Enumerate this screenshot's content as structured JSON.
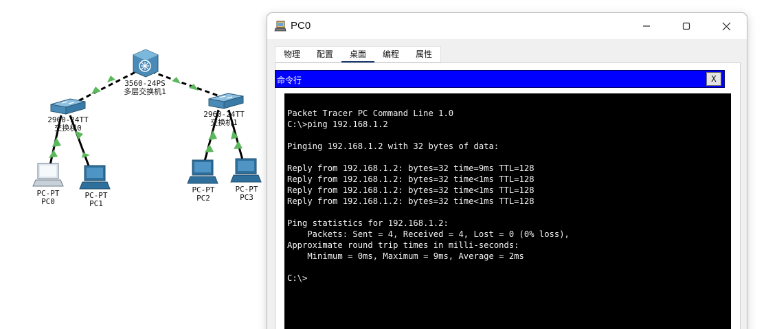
{
  "topology": {
    "devices": [
      {
        "id": "multilayer-switch",
        "model": "3560-24PS",
        "name": "多层交换机1"
      },
      {
        "id": "switch-0",
        "model": "2960-24TT",
        "name": "交换机0"
      },
      {
        "id": "switch-1",
        "model": "2960-24TT",
        "name": "交换机1"
      },
      {
        "id": "pc0",
        "model": "PC-PT",
        "name": "PC0"
      },
      {
        "id": "pc1",
        "model": "PC-PT",
        "name": "PC1"
      },
      {
        "id": "pc2",
        "model": "PC-PT",
        "name": "PC2"
      },
      {
        "id": "pc3",
        "model": "PC-PT",
        "name": "PC3"
      }
    ],
    "link_status_color": "#5cb85c"
  },
  "window": {
    "title": "PC0",
    "icons": {
      "app": "packet-tracer-pc-icon",
      "minimize": "minimize-icon",
      "maximize": "maximize-icon",
      "close": "close-icon"
    }
  },
  "tabs": [
    {
      "label": "物理",
      "active": false
    },
    {
      "label": "配置",
      "active": false
    },
    {
      "label": "桌面",
      "active": true
    },
    {
      "label": "编程",
      "active": false
    },
    {
      "label": "属性",
      "active": false
    }
  ],
  "command_prompt": {
    "header_title": "命令行",
    "header_color": "#0000ff",
    "close_label": "X",
    "lines": [
      "Packet Tracer PC Command Line 1.0",
      "C:\\>ping 192.168.1.2",
      "",
      "Pinging 192.168.1.2 with 32 bytes of data:",
      "",
      "Reply from 192.168.1.2: bytes=32 time=9ms TTL=128",
      "Reply from 192.168.1.2: bytes=32 time<1ms TTL=128",
      "Reply from 192.168.1.2: bytes=32 time<1ms TTL=128",
      "Reply from 192.168.1.2: bytes=32 time<1ms TTL=128",
      "",
      "Ping statistics for 192.168.1.2:",
      "    Packets: Sent = 4, Received = 4, Lost = 0 (0% loss),",
      "Approximate round trip times in milli-seconds:",
      "    Minimum = 0ms, Maximum = 9ms, Average = 2ms",
      "",
      "C:\\>"
    ]
  }
}
